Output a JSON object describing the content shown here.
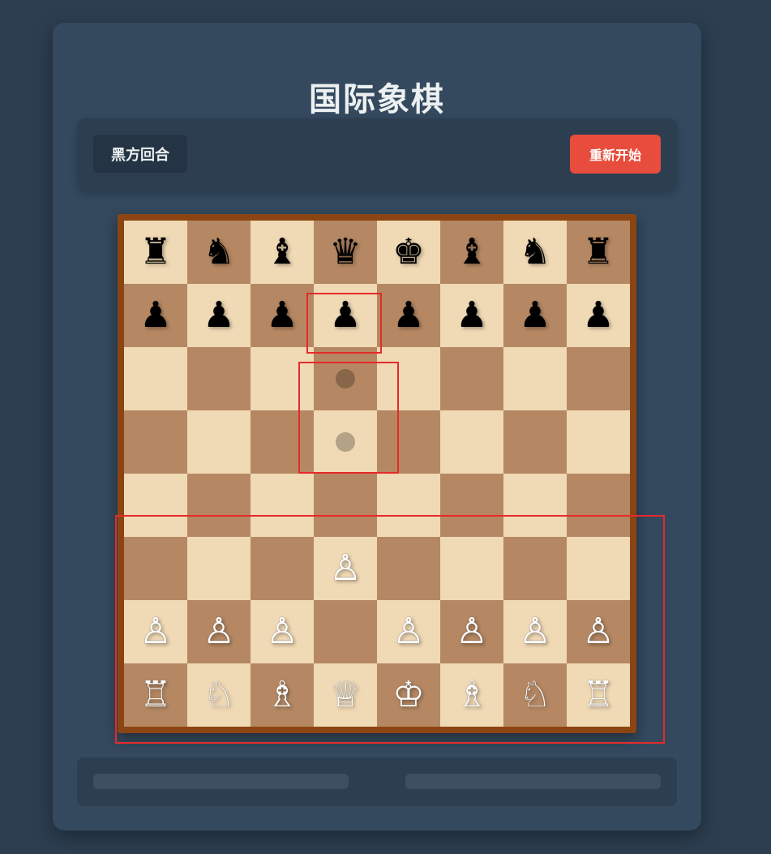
{
  "header": {
    "title": "国际象棋"
  },
  "status": {
    "turn_label": "黑方回合"
  },
  "controls": {
    "restart_label": "重新开始"
  },
  "colors": {
    "light_square": "#f0d9b5",
    "dark_square": "#b58863",
    "board_frame": "#8b4513",
    "restart_button": "#e74c3c",
    "highlight": "#e62a2a"
  },
  "board": {
    "ranks": [
      [
        "bR",
        "bN",
        "bB",
        "bQ",
        "bK",
        "bB",
        "bN",
        "bR"
      ],
      [
        "bP",
        "bP",
        "bP",
        "bP",
        "bP",
        "bP",
        "bP",
        "bP"
      ],
      [
        "",
        "",
        "",
        "",
        "",
        "",
        "",
        ""
      ],
      [
        "",
        "",
        "",
        "",
        "",
        "",
        "",
        ""
      ],
      [
        "",
        "",
        "",
        "",
        "",
        "",
        "",
        ""
      ],
      [
        "",
        "",
        "",
        "wP",
        "",
        "",
        "",
        ""
      ],
      [
        "wP",
        "wP",
        "wP",
        "",
        "wP",
        "wP",
        "wP",
        "wP"
      ],
      [
        "wR",
        "wN",
        "wB",
        "wQ",
        "wK",
        "wB",
        "wN",
        "wR"
      ]
    ],
    "move_hints": [
      [
        2,
        3
      ],
      [
        3,
        3
      ]
    ],
    "piece_glyphs": {
      "K": "♚",
      "Q": "♛",
      "R": "♜",
      "B": "♝",
      "N": "♞",
      "P": "♟",
      "wK": "♔",
      "wQ": "♕",
      "wR": "♖",
      "wB": "♗",
      "wN": "♘",
      "wP": "♙"
    },
    "piece_names": {
      "K": "king",
      "Q": "queen",
      "R": "rook",
      "B": "bishop",
      "N": "knight",
      "P": "pawn"
    }
  },
  "footer": {
    "slots": [
      "",
      ""
    ]
  }
}
